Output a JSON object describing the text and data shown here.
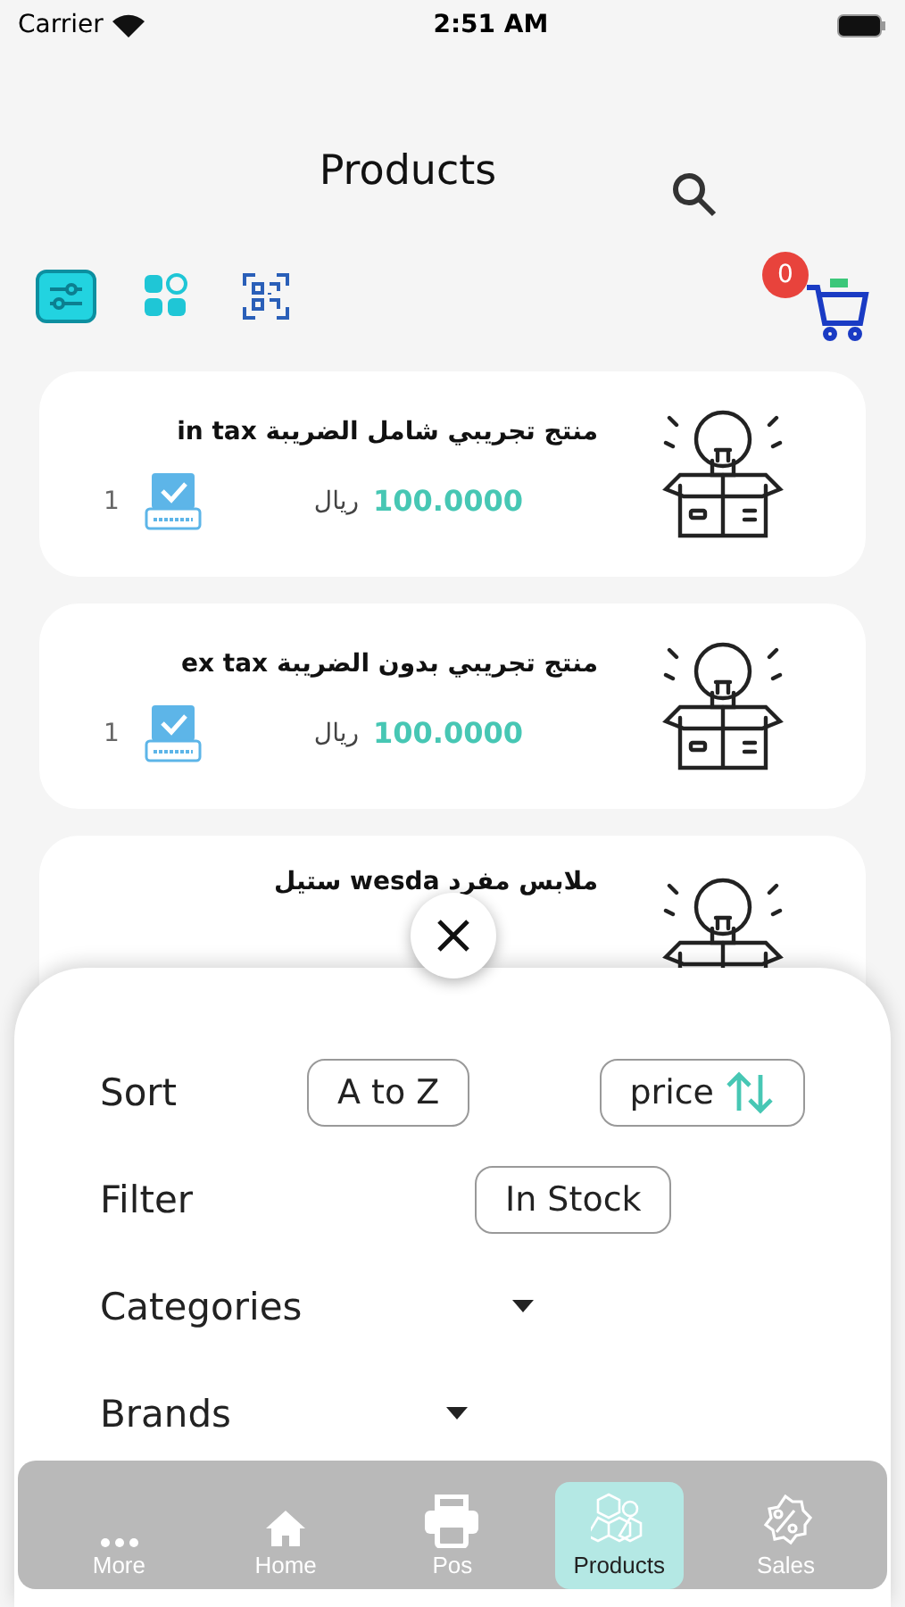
{
  "status_bar": {
    "carrier": "Carrier",
    "time": "2:51 AM"
  },
  "header": {
    "title": "Products"
  },
  "tools": [
    {
      "kind": "filter",
      "selected": true
    },
    {
      "kind": "grid",
      "selected": false
    },
    {
      "kind": "qr",
      "selected": false
    }
  ],
  "cart": {
    "count": "0"
  },
  "products": [
    {
      "name": "منتج تجريبي شامل الضريبة in tax",
      "price": "100.0000",
      "currency": "ريال",
      "stock": "1"
    },
    {
      "name": "منتج تجريبي بدون الضريبة ex tax",
      "price": "100.0000",
      "currency": "ريال",
      "stock": "1"
    },
    {
      "name": "ملابس مفرد wesda ستيل"
    }
  ],
  "sheet": {
    "sort": {
      "label": "Sort",
      "options": [
        {
          "label": "A to Z",
          "kind": "plain"
        },
        {
          "label": "price",
          "kind": "arrows"
        }
      ]
    },
    "filter": {
      "label": "Filter",
      "options": [
        "In Stock"
      ]
    },
    "dropdowns": [
      {
        "label": "Categories"
      },
      {
        "label": "Brands"
      }
    ]
  },
  "nav": [
    {
      "label": "More",
      "kind": "more",
      "selected": false
    },
    {
      "label": "Home",
      "kind": "home",
      "selected": false
    },
    {
      "label": "Pos",
      "kind": "printer",
      "selected": false
    },
    {
      "label": "Products",
      "kind": "boxes",
      "selected": true
    },
    {
      "label": "Sales",
      "kind": "percent",
      "selected": false
    }
  ]
}
